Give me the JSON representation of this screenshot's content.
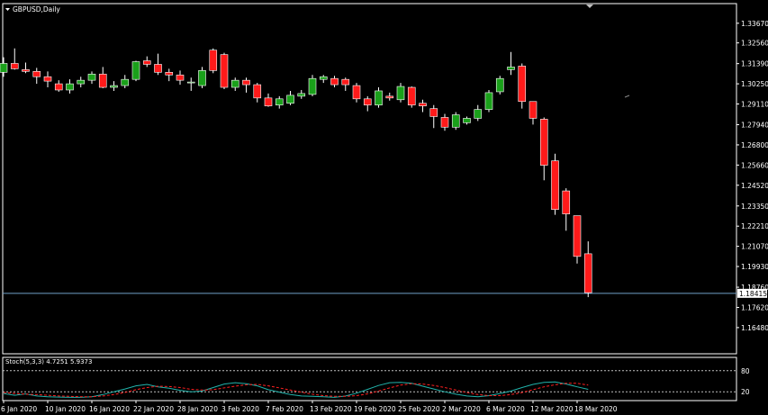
{
  "symbol_label": "GBPUSD,Daily",
  "current_price_label": "1.18415",
  "indicator_label": "Stoch(5,3,3) 4.7251 5.9373",
  "colors": {
    "background": "#000000",
    "frame": "#ffffff",
    "bull_body": "#1aa01a",
    "bear_body": "#ff1a1a",
    "wick": "#ffffff",
    "price_line": "#6fa0c8",
    "stoch_main": "#20b2aa",
    "stoch_signal": "#ff2020",
    "level_line": "#c0c0c0"
  },
  "chart_data": [
    {
      "type": "candlestick",
      "title": "GBPUSD,Daily",
      "ylim": [
        1.15,
        1.3478
      ],
      "y_ticks": [
        "1.33670",
        "1.32560",
        "1.31390",
        "1.30250",
        "1.29110",
        "1.27940",
        "1.26800",
        "1.25660",
        "1.24520",
        "1.23350",
        "1.22210",
        "1.21070",
        "1.19930",
        "1.18760",
        "1.17620",
        "1.16480"
      ],
      "y_tick_values": [
        1.3367,
        1.3256,
        1.3139,
        1.3025,
        1.2911,
        1.2794,
        1.268,
        1.2566,
        1.2452,
        1.2335,
        1.2221,
        1.2107,
        1.1993,
        1.1876,
        1.1762,
        1.1648
      ],
      "x_ticks": [
        "6 Jan 2020",
        "10 Jan 2020",
        "16 Jan 2020",
        "22 Jan 2020",
        "28 Jan 2020",
        "3 Feb 2020",
        "7 Feb 2020",
        "13 Feb 2020",
        "19 Feb 2020",
        "25 Feb 2020",
        "2 Mar 2020",
        "6 Mar 2020",
        "12 Mar 2020",
        "18 Mar 2020"
      ],
      "x_tick_index": [
        0,
        4,
        8,
        12,
        16,
        20,
        24,
        28,
        32,
        36,
        40,
        44,
        48,
        52
      ],
      "current_price": 1.18415,
      "candles": [
        {
          "o": 1.309,
          "h": 1.3175,
          "l": 1.3065,
          "c": 1.314
        },
        {
          "o": 1.314,
          "h": 1.3225,
          "l": 1.3105,
          "c": 1.311
        },
        {
          "o": 1.3105,
          "h": 1.3145,
          "l": 1.3085,
          "c": 1.3095
        },
        {
          "o": 1.3095,
          "h": 1.3115,
          "l": 1.3025,
          "c": 1.3065
        },
        {
          "o": 1.3065,
          "h": 1.3095,
          "l": 1.3005,
          "c": 1.304
        },
        {
          "o": 1.3025,
          "h": 1.3045,
          "l": 1.298,
          "c": 1.299
        },
        {
          "o": 1.299,
          "h": 1.305,
          "l": 1.297,
          "c": 1.3025
        },
        {
          "o": 1.3025,
          "h": 1.3065,
          "l": 1.3005,
          "c": 1.3045
        },
        {
          "o": 1.3045,
          "h": 1.3095,
          "l": 1.3025,
          "c": 1.308
        },
        {
          "o": 1.308,
          "h": 1.312,
          "l": 1.3,
          "c": 1.3005
        },
        {
          "o": 1.3005,
          "h": 1.304,
          "l": 1.2985,
          "c": 1.3015
        },
        {
          "o": 1.3015,
          "h": 1.3075,
          "l": 1.3,
          "c": 1.305
        },
        {
          "o": 1.305,
          "h": 1.3155,
          "l": 1.304,
          "c": 1.315
        },
        {
          "o": 1.3155,
          "h": 1.318,
          "l": 1.312,
          "c": 1.3135
        },
        {
          "o": 1.3135,
          "h": 1.3195,
          "l": 1.3075,
          "c": 1.309
        },
        {
          "o": 1.309,
          "h": 1.311,
          "l": 1.304,
          "c": 1.3075
        },
        {
          "o": 1.3075,
          "h": 1.31,
          "l": 1.302,
          "c": 1.3045
        },
        {
          "o": 1.303,
          "h": 1.306,
          "l": 1.2985,
          "c": 1.3035
        },
        {
          "o": 1.3015,
          "h": 1.312,
          "l": 1.3,
          "c": 1.31
        },
        {
          "o": 1.3215,
          "h": 1.3225,
          "l": 1.3085,
          "c": 1.31
        },
        {
          "o": 1.319,
          "h": 1.32,
          "l": 1.2995,
          "c": 1.3005
        },
        {
          "o": 1.3005,
          "h": 1.306,
          "l": 1.2985,
          "c": 1.3045
        },
        {
          "o": 1.3045,
          "h": 1.306,
          "l": 1.2975,
          "c": 1.302
        },
        {
          "o": 1.302,
          "h": 1.303,
          "l": 1.292,
          "c": 1.2945
        },
        {
          "o": 1.2945,
          "h": 1.297,
          "l": 1.2895,
          "c": 1.29
        },
        {
          "o": 1.2905,
          "h": 1.2955,
          "l": 1.2885,
          "c": 1.294
        },
        {
          "o": 1.2915,
          "h": 1.2985,
          "l": 1.2905,
          "c": 1.296
        },
        {
          "o": 1.2955,
          "h": 1.299,
          "l": 1.294,
          "c": 1.297
        },
        {
          "o": 1.2965,
          "h": 1.3075,
          "l": 1.2955,
          "c": 1.3055
        },
        {
          "o": 1.305,
          "h": 1.3075,
          "l": 1.303,
          "c": 1.3065
        },
        {
          "o": 1.3055,
          "h": 1.307,
          "l": 1.3005,
          "c": 1.302
        },
        {
          "o": 1.305,
          "h": 1.306,
          "l": 1.2985,
          "c": 1.302
        },
        {
          "o": 1.3015,
          "h": 1.303,
          "l": 1.292,
          "c": 1.294
        },
        {
          "o": 1.294,
          "h": 1.2955,
          "l": 1.287,
          "c": 1.2905
        },
        {
          "o": 1.2905,
          "h": 1.3005,
          "l": 1.289,
          "c": 1.2985
        },
        {
          "o": 1.2955,
          "h": 1.2975,
          "l": 1.293,
          "c": 1.2945
        },
        {
          "o": 1.2935,
          "h": 1.303,
          "l": 1.292,
          "c": 1.301
        },
        {
          "o": 1.3005,
          "h": 1.301,
          "l": 1.289,
          "c": 1.2905
        },
        {
          "o": 1.2915,
          "h": 1.2935,
          "l": 1.2865,
          "c": 1.29
        },
        {
          "o": 1.2885,
          "h": 1.2905,
          "l": 1.2775,
          "c": 1.284
        },
        {
          "o": 1.2835,
          "h": 1.2855,
          "l": 1.276,
          "c": 1.278
        },
        {
          "o": 1.278,
          "h": 1.2865,
          "l": 1.2765,
          "c": 1.285
        },
        {
          "o": 1.2805,
          "h": 1.284,
          "l": 1.2795,
          "c": 1.283
        },
        {
          "o": 1.283,
          "h": 1.2905,
          "l": 1.2815,
          "c": 1.288
        },
        {
          "o": 1.288,
          "h": 1.299,
          "l": 1.2865,
          "c": 1.2975
        },
        {
          "o": 1.298,
          "h": 1.307,
          "l": 1.2965,
          "c": 1.3055
        },
        {
          "o": 1.3105,
          "h": 1.3205,
          "l": 1.3075,
          "c": 1.312
        },
        {
          "o": 1.3125,
          "h": 1.314,
          "l": 1.2885,
          "c": 1.2925
        },
        {
          "o": 1.2925,
          "h": 1.2925,
          "l": 1.2795,
          "c": 1.283
        },
        {
          "o": 1.2825,
          "h": 1.2835,
          "l": 1.248,
          "c": 1.2565
        },
        {
          "o": 1.259,
          "h": 1.263,
          "l": 1.2285,
          "c": 1.2315
        },
        {
          "o": 1.242,
          "h": 1.2435,
          "l": 1.2195,
          "c": 1.229
        },
        {
          "o": 1.228,
          "h": 1.228,
          "l": 1.201,
          "c": 1.205
        },
        {
          "o": 1.2065,
          "h": 1.2135,
          "l": 1.182,
          "c": 1.1845
        }
      ]
    },
    {
      "type": "line",
      "title": "Stoch(5,3,3) 4.7251 5.9373",
      "ylim": [
        0,
        100
      ],
      "levels": [
        80,
        20
      ],
      "y_ticks": [
        "80",
        "20"
      ],
      "series": [
        {
          "values": [
            15,
            10,
            14,
            8,
            6,
            5,
            4,
            4,
            6,
            12,
            20,
            28,
            37,
            41,
            34,
            30,
            24,
            20,
            22,
            32,
            42,
            46,
            43,
            37,
            26,
            19,
            12,
            8,
            7,
            6,
            4,
            8,
            16,
            27,
            38,
            46,
            47,
            44,
            36,
            28,
            20,
            13,
            8,
            6,
            9,
            15,
            22,
            32,
            41,
            47,
            48,
            42,
            34,
            27
          ]
        },
        {
          "values": [
            18,
            15,
            13,
            12,
            10,
            8,
            7,
            6,
            6,
            8,
            12,
            18,
            26,
            32,
            36,
            35,
            32,
            27,
            25,
            26,
            31,
            36,
            40,
            41,
            37,
            31,
            25,
            19,
            13,
            9,
            7,
            7,
            9,
            14,
            22,
            31,
            39,
            43,
            42,
            38,
            32,
            25,
            18,
            12,
            9,
            9,
            12,
            18,
            26,
            34,
            40,
            44,
            44,
            39
          ]
        }
      ]
    }
  ]
}
